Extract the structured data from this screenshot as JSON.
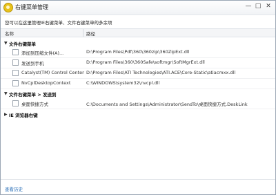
{
  "window": {
    "title": "右键菜单管理",
    "minimize": "—",
    "maximize": "□",
    "close": "✕"
  },
  "description": "您可以在这里管理IE右键菜单、文件右键菜单的多余项",
  "columns": {
    "name": "名称",
    "path": "路径"
  },
  "groups": [
    {
      "label": "文件右键菜单",
      "expanded": true,
      "items": [
        {
          "name": "添加到压缩文件(A)...",
          "path": "D:\\Program Files\\Pdf\\360\\360zip\\360ZipExt.dll"
        },
        {
          "name": "发送到手机",
          "path": "D:\\Program Files\\360\\360Safe\\softmgr\\SoftMgrExt.dll"
        },
        {
          "name": "Catalyst(TM) Control Center",
          "path": "D:\\Program Files\\ATI Technologies\\ATI.ACE\\Core-Static\\atiacmxx.dll"
        },
        {
          "name": "NvCplDesktopContext",
          "path": "C:\\WINDOWS\\system32\\nvcpl.dll"
        }
      ]
    },
    {
      "label": "文件右键菜单 > 发送到",
      "expanded": true,
      "items": [
        {
          "name": "桌面快捷方式",
          "path": "C:\\Documents and Settings\\Administrator\\SendTo\\桌面快捷方式.DeskLink"
        }
      ]
    },
    {
      "label": "IE 浏览器右键",
      "expanded": false,
      "items": []
    }
  ],
  "footer": {
    "history_link": "查看历史"
  },
  "icons": {
    "app": "360-logo-icon",
    "expanded": "triangle-down-icon",
    "collapsed": "triangle-right-icon"
  },
  "colors": {
    "link": "#2a6fb8",
    "header_bg": "#f4f5f7"
  }
}
